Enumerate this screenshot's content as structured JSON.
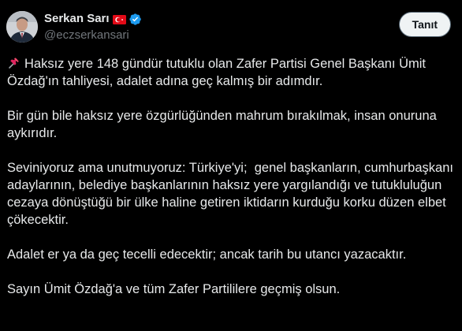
{
  "author": {
    "display_name": "Serkan Sarı",
    "handle": "@eczserkansari",
    "flag_icon": "turkey-flag-icon",
    "verified_icon": "verified-badge-icon",
    "verified_color": "#1d9bf0"
  },
  "follow_button": {
    "label": "Tanıt"
  },
  "tweet": {
    "pin_icon": "pushpin-icon",
    "paragraphs": [
      "Haksız yere 148 gündür tutuklu olan Zafer Partisi Genel Başkanı Ümit Özdağ'ın tahliyesi, adalet adına geç kalmış bir adımdır.",
      "Bir gün bile haksız yere özgürlüğünden mahrum bırakılmak, insan onuruna aykırıdır.",
      "Seviniyoruz ama unutmuyoruz: Türkiye'yi;  genel başkanların, cumhurbaşkanı adaylarının, belediye başkanlarının haksız yere yargılandığı ve tutukluluğun cezaya dönüştüğü bir ülke haline getiren iktidarın kurduğu korku düzen elbet çökecektir.",
      "Adalet er ya da geç tecelli edecektir; ancak tarih bu utancı yazacaktır.",
      "Sayın Ümit Özdağ'a ve tüm Zafer Partililere geçmiş olsun."
    ]
  },
  "colors": {
    "background": "#000000",
    "text": "#e7e9ea",
    "secondary_text": "#71767b",
    "button_bg": "#eff3f4"
  }
}
